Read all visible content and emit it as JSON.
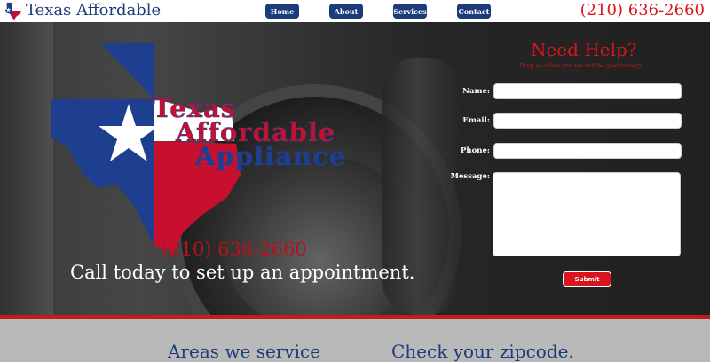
{
  "header": {
    "brand_name": "Texas Affordable",
    "phone": "(210) 636-2660",
    "nav": [
      {
        "label": "Home"
      },
      {
        "label": "About"
      },
      {
        "label": "Services"
      },
      {
        "label": "Contact"
      }
    ]
  },
  "hero": {
    "logo_text": [
      "Texas",
      "Affordable",
      "Appliance"
    ],
    "phone": "(210) 636-2660",
    "cta": "Call today to set up an appointment."
  },
  "form": {
    "title": "Need Help?",
    "subtitle": "Drop us a line and we will be glad to help.",
    "labels": {
      "name": "Name:",
      "email": "Email:",
      "phone": "Phone:",
      "message": "Message:"
    },
    "values": {
      "name": "",
      "email": "",
      "phone": "",
      "message": ""
    },
    "submit_label": "Submit"
  },
  "bottom": {
    "areas_heading": "Areas we service",
    "zip_heading": "Check your zipcode."
  },
  "colors": {
    "brand_blue": "#1c3b7a",
    "brand_red": "#d8141d",
    "flag_blue": "#1e3f8f",
    "flag_red": "#c8102e"
  }
}
